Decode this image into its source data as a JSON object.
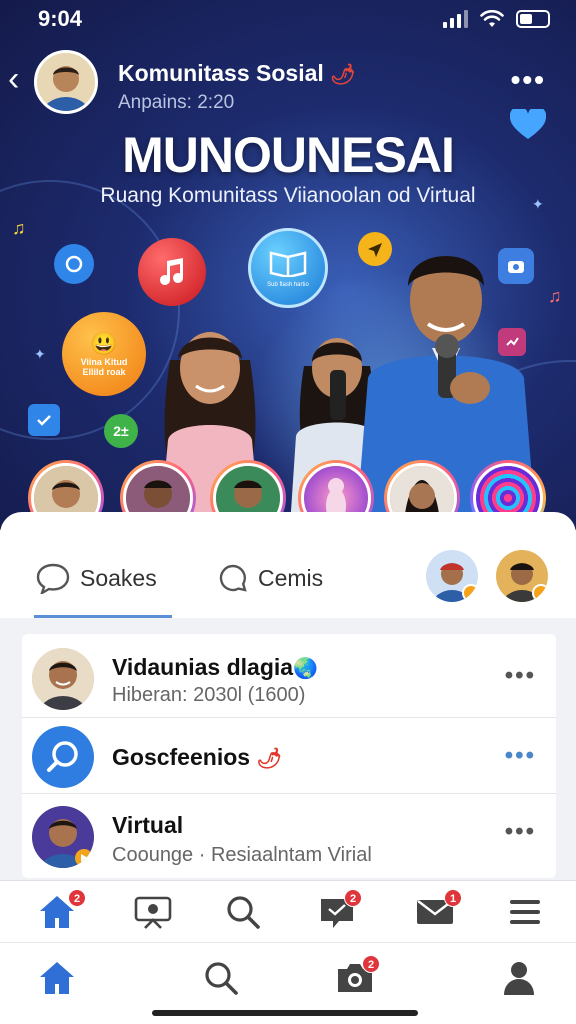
{
  "status": {
    "time": "9:04"
  },
  "header": {
    "channel_name": "Komunitass Sosial",
    "channel_sub": "Anpains: 2:20"
  },
  "hero": {
    "title": "MUNOUNESAI",
    "subtitle": "Ruang Komunitass Viianoolan od Virtual",
    "bubble_text_orange": "Viina Kitud Ellild roak",
    "bubble_text_blue": "Sub flash hartio"
  },
  "tabs": [
    {
      "label": "Soakes",
      "icon": "chat-bubble-icon"
    },
    {
      "label": "Cemis",
      "icon": "comment-icon"
    }
  ],
  "feed": [
    {
      "title": "Vidaunias dlagia",
      "subtitle": "Hiberan: 2030l (1600)",
      "emoji": "🌏"
    },
    {
      "title": "Goscfeenios",
      "subtitle": "",
      "emoji": "🌶"
    },
    {
      "title": "Virtual",
      "subtitle": "Coounge · Resiaalntam Virial"
    }
  ],
  "nav_top": {
    "items": [
      "home-icon",
      "presentation-icon",
      "search-icon",
      "chat-icon",
      "mail-icon",
      "menu-icon"
    ],
    "badges": {
      "home": "2",
      "chat": "2",
      "mail": "1"
    }
  },
  "nav_bottom": {
    "items": [
      "home-icon",
      "search-icon",
      "camera-icon",
      "profile-icon"
    ],
    "badges": {
      "camera": "2"
    }
  },
  "colors": {
    "accent": "#2f6fd6",
    "hero_bg": "#1d2b6e",
    "badge": "#e0353b"
  }
}
